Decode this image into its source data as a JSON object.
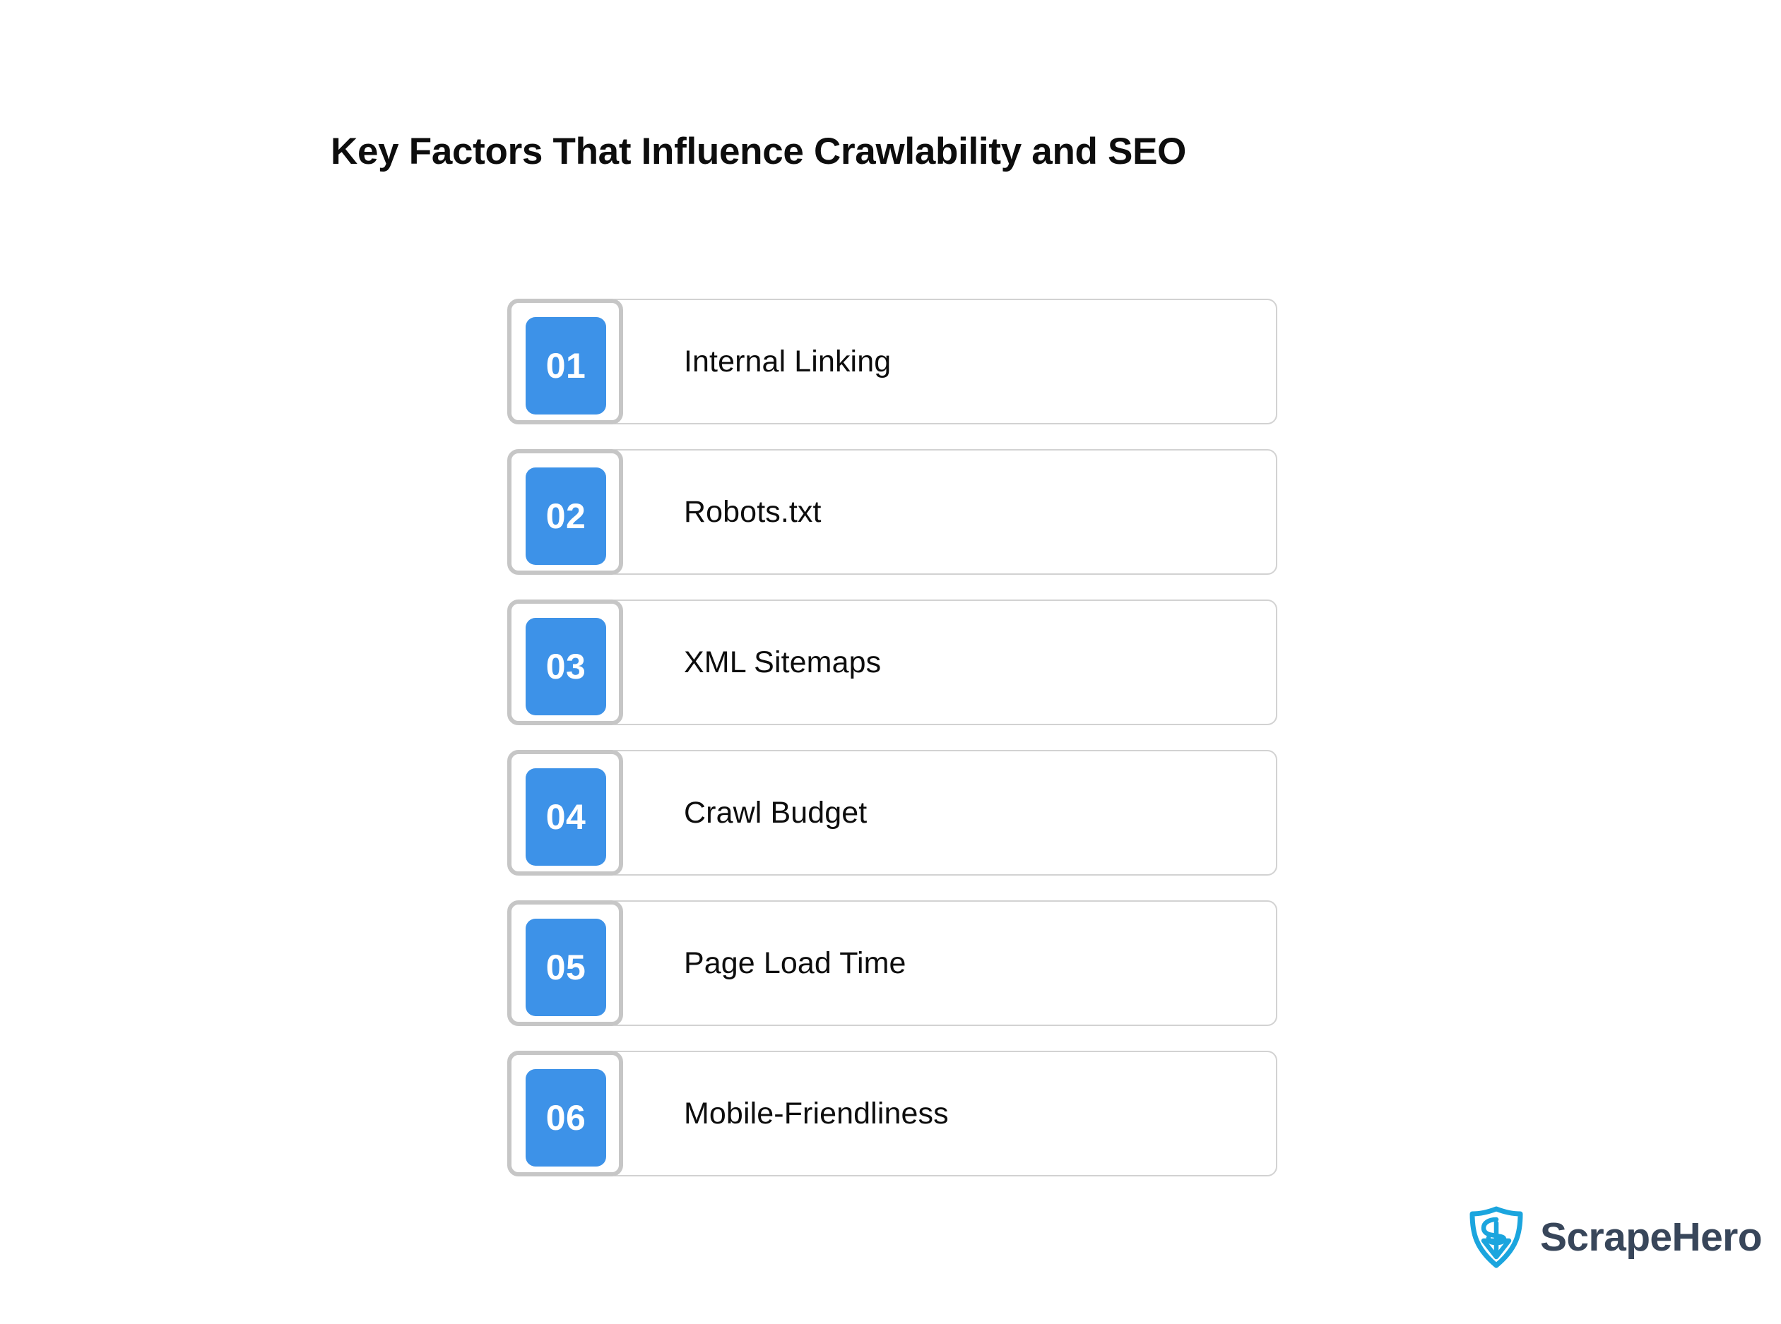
{
  "page": {
    "title": "Key Factors That Influence Crawlability and SEO",
    "background_color": "#ffffff"
  },
  "colors": {
    "badge_blue": "#3d92e8",
    "badge_text": "#ffffff",
    "frame_gray": "#c6c6c6",
    "panel_border": "#d2d2d2",
    "text_dark": "#0d0d0d",
    "brand_cyan": "#1ba5de",
    "brand_navy": "#38465a"
  },
  "factors": [
    {
      "number": "01",
      "label": "Internal Linking"
    },
    {
      "number": "02",
      "label": "Robots.txt"
    },
    {
      "number": "03",
      "label": "XML Sitemaps"
    },
    {
      "number": "04",
      "label": "Crawl Budget"
    },
    {
      "number": "05",
      "label": "Page Load Time"
    },
    {
      "number": "06",
      "label": "Mobile-Friendliness"
    }
  ],
  "brand": {
    "name": "ScrapeHero",
    "mark_icon": "scrapehero-shield-icon"
  }
}
